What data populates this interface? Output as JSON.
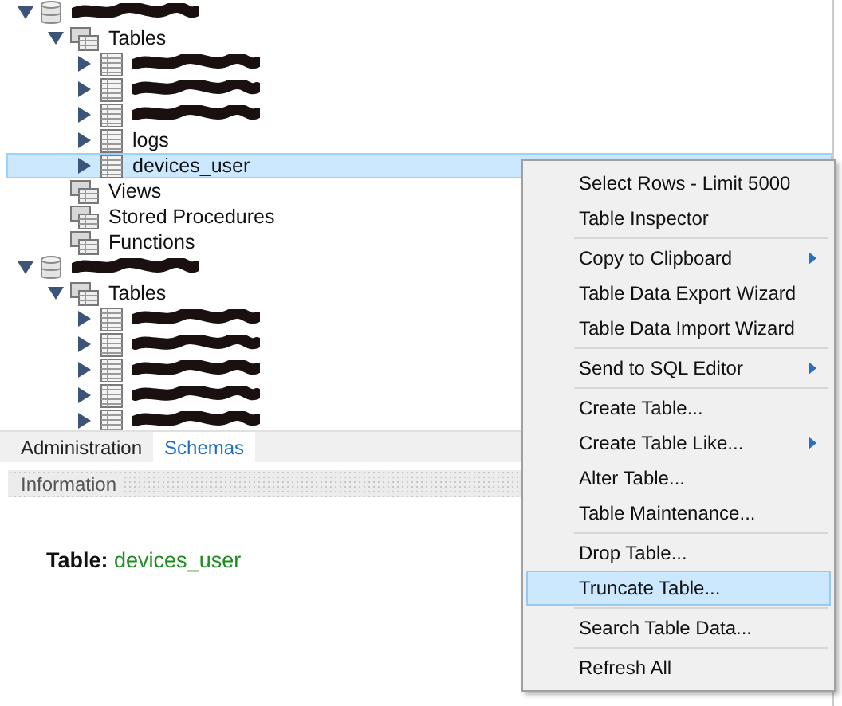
{
  "tree": [
    {
      "kind": "schema",
      "redacted": true,
      "expanded": true,
      "selected": false,
      "children": [
        {
          "kind": "folder",
          "label": "Tables",
          "expanded": true,
          "selected": false,
          "children": [
            {
              "kind": "table",
              "redacted": true,
              "expanded": false,
              "selected": false
            },
            {
              "kind": "table",
              "redacted": true,
              "expanded": false,
              "selected": false
            },
            {
              "kind": "table",
              "redacted": true,
              "expanded": false,
              "selected": false
            },
            {
              "kind": "table",
              "label": "logs",
              "expanded": false,
              "selected": false
            },
            {
              "kind": "table",
              "label": "devices_user",
              "expanded": false,
              "selected": true
            }
          ]
        },
        {
          "kind": "folder",
          "label": "Views",
          "selected": false
        },
        {
          "kind": "folder",
          "label": "Stored Procedures",
          "selected": false
        },
        {
          "kind": "folder",
          "label": "Functions",
          "selected": false
        }
      ]
    },
    {
      "kind": "schema",
      "redacted": true,
      "expanded": true,
      "selected": false,
      "children": [
        {
          "kind": "folder",
          "label": "Tables",
          "expanded": true,
          "selected": false,
          "children": [
            {
              "kind": "table",
              "redacted": true,
              "expanded": false,
              "selected": false
            },
            {
              "kind": "table",
              "redacted": true,
              "expanded": false,
              "selected": false
            },
            {
              "kind": "table",
              "redacted": true,
              "expanded": false,
              "selected": false
            },
            {
              "kind": "table",
              "redacted": true,
              "expanded": false,
              "selected": false
            },
            {
              "kind": "table",
              "redacted": true,
              "expanded": false,
              "selected": false
            }
          ]
        }
      ]
    }
  ],
  "tabs": [
    {
      "label": "Administration",
      "selected": false
    },
    {
      "label": "Schemas",
      "selected": true
    }
  ],
  "information": {
    "title": "Information",
    "object_label": "Table:",
    "object_name": "devices_user"
  },
  "context_menu": [
    [
      {
        "label": "Select Rows - Limit 5000",
        "submenu": false,
        "selected": false
      },
      {
        "label": "Table Inspector",
        "submenu": false,
        "selected": false
      }
    ],
    [
      {
        "label": "Copy to Clipboard",
        "submenu": true,
        "selected": false
      },
      {
        "label": "Table Data Export Wizard",
        "submenu": false,
        "selected": false
      },
      {
        "label": "Table Data Import Wizard",
        "submenu": false,
        "selected": false
      }
    ],
    [
      {
        "label": "Send to SQL Editor",
        "submenu": true,
        "selected": false
      }
    ],
    [
      {
        "label": "Create Table...",
        "submenu": false,
        "selected": false
      },
      {
        "label": "Create Table Like...",
        "submenu": true,
        "selected": false
      },
      {
        "label": "Alter Table...",
        "submenu": false,
        "selected": false
      },
      {
        "label": "Table Maintenance...",
        "submenu": false,
        "selected": false
      }
    ],
    [
      {
        "label": "Drop Table...",
        "submenu": false,
        "selected": false
      },
      {
        "label": "Truncate Table...",
        "submenu": false,
        "selected": true
      }
    ],
    [
      {
        "label": "Search Table Data...",
        "submenu": false,
        "selected": false
      }
    ],
    [
      {
        "label": "Refresh All",
        "submenu": false,
        "selected": false
      }
    ]
  ]
}
